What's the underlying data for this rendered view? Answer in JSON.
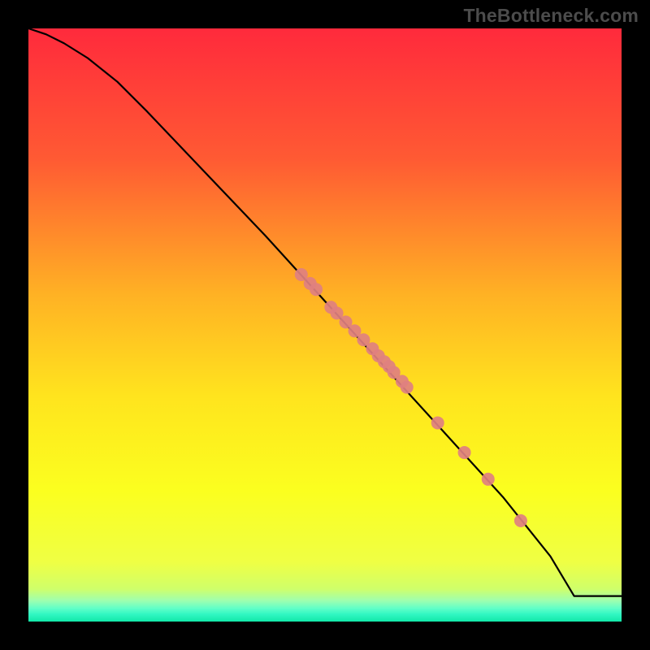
{
  "watermark": "TheBottleneck.com",
  "chart_data": {
    "type": "line",
    "title": "",
    "xlabel": "",
    "ylabel": "",
    "xlim": [
      0,
      100
    ],
    "ylim": [
      0,
      100
    ],
    "grid": false,
    "legend": false,
    "background_gradient_stops": [
      {
        "offset": 0.0,
        "color": "#ff2a3c"
      },
      {
        "offset": 0.22,
        "color": "#ff5a33"
      },
      {
        "offset": 0.45,
        "color": "#ffb224"
      },
      {
        "offset": 0.62,
        "color": "#ffe41e"
      },
      {
        "offset": 0.78,
        "color": "#fbff1f"
      },
      {
        "offset": 0.9,
        "color": "#efff44"
      },
      {
        "offset": 0.945,
        "color": "#cfff6a"
      },
      {
        "offset": 0.965,
        "color": "#9dffb0"
      },
      {
        "offset": 0.978,
        "color": "#5fffc8"
      },
      {
        "offset": 0.988,
        "color": "#30f7c2"
      },
      {
        "offset": 1.0,
        "color": "#12e7a8"
      }
    ],
    "series": [
      {
        "name": "bottleneck-curve",
        "color": "#000000",
        "x": [
          0,
          3,
          6,
          10,
          15,
          20,
          30,
          40,
          50,
          60,
          70,
          80,
          88,
          92,
          100
        ],
        "y": [
          100,
          99,
          97.5,
          95,
          91,
          86,
          75.5,
          65,
          54,
          43,
          32,
          21,
          11,
          4.3,
          4.3
        ]
      }
    ],
    "scatter_points": {
      "name": "highlight-points",
      "color": "#e08080",
      "radius": 8,
      "x": [
        46,
        47.5,
        48.5,
        51,
        52,
        53.5,
        55,
        56.5,
        58,
        59,
        60,
        60.8,
        61.6,
        63,
        63.8,
        69,
        73.5,
        77.5,
        83
      ],
      "y": [
        58.5,
        57,
        56,
        53,
        52,
        50.5,
        49,
        47.5,
        46,
        44.8,
        43.8,
        43,
        42,
        40.5,
        39.5,
        33.5,
        28.5,
        24,
        17
      ]
    }
  }
}
